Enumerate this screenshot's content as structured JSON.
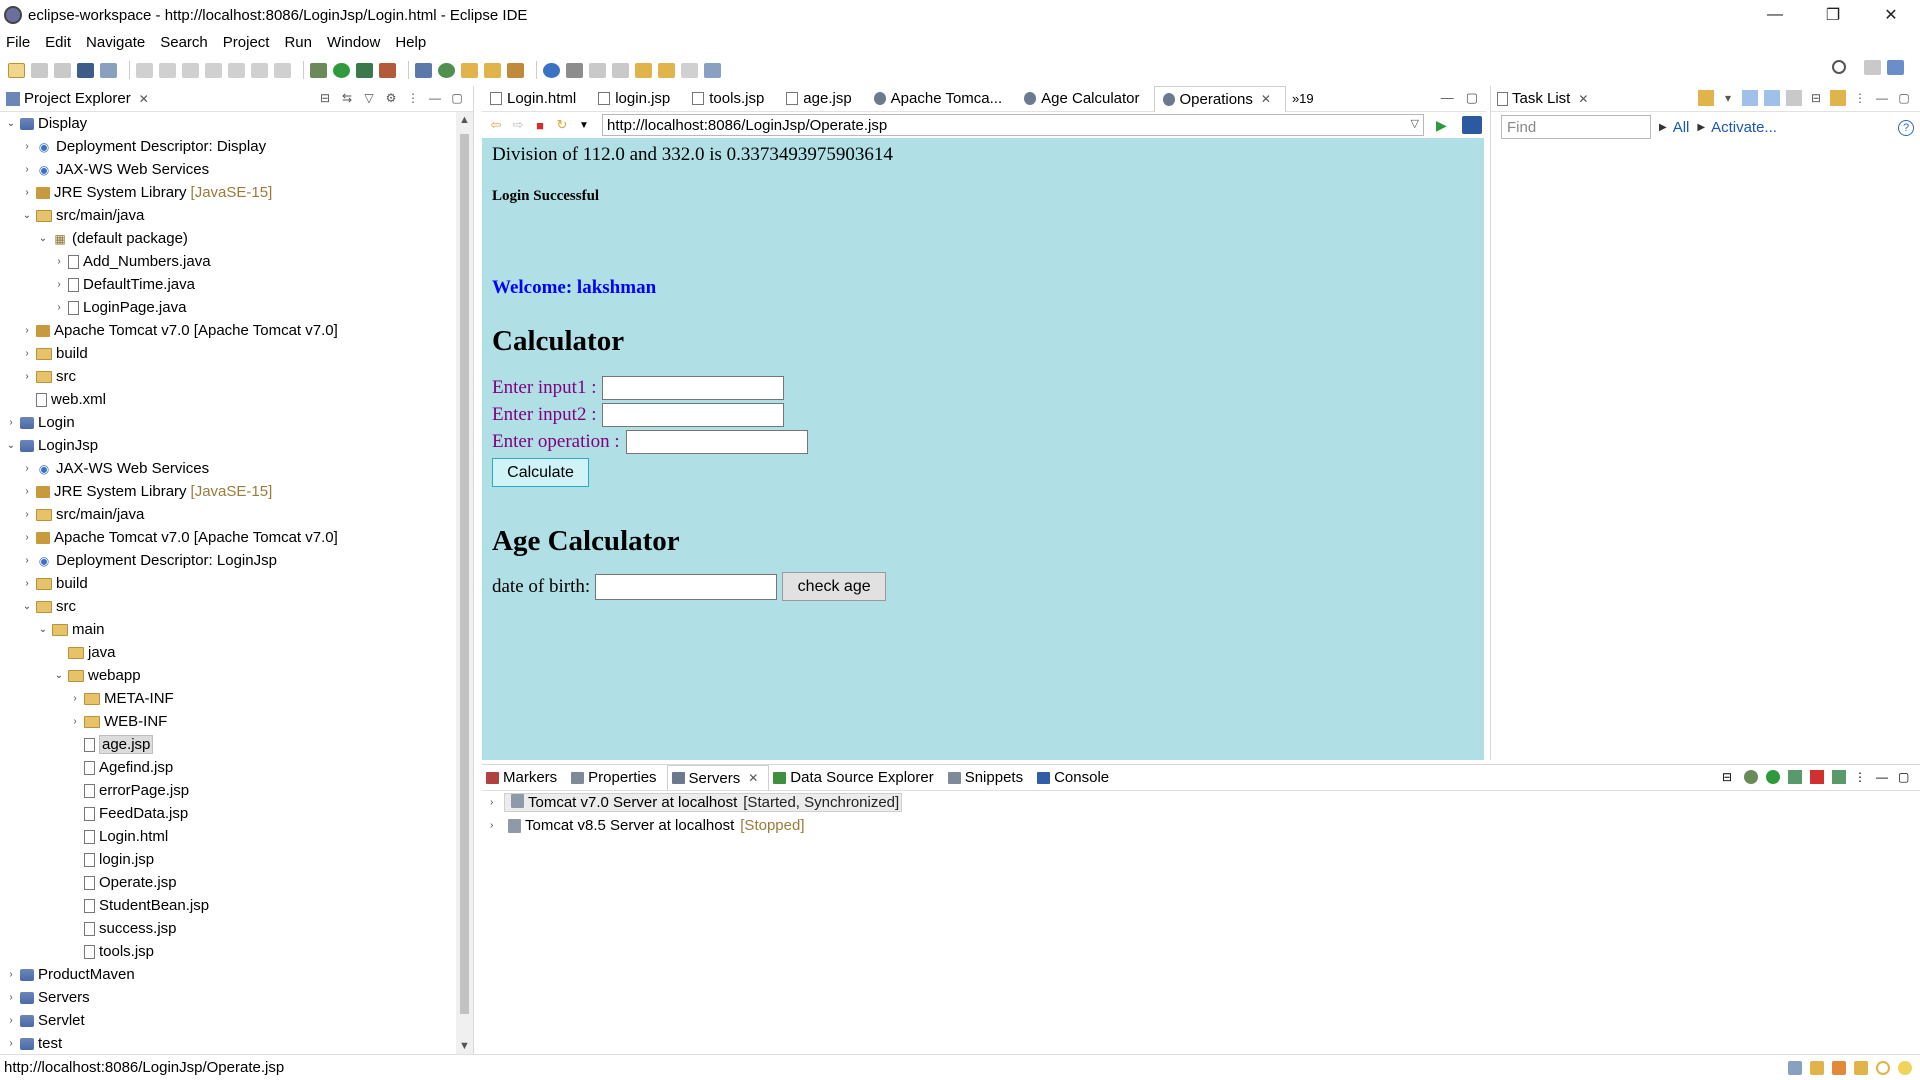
{
  "window": {
    "title": "eclipse-workspace - http://localhost:8086/LoginJsp/Login.html - Eclipse IDE",
    "controls": [
      "—",
      "❐",
      "✕"
    ]
  },
  "menu": [
    "File",
    "Edit",
    "Navigate",
    "Search",
    "Project",
    "Run",
    "Window",
    "Help"
  ],
  "explorer": {
    "title": "Project Explorer",
    "tree": [
      {
        "depth": 0,
        "twisty": "open",
        "icon": "project",
        "label": "Display"
      },
      {
        "depth": 1,
        "twisty": "closed",
        "icon": "globe",
        "label": "Deployment Descriptor: Display"
      },
      {
        "depth": 1,
        "twisty": "closed",
        "icon": "globe",
        "label": "JAX-WS Web Services"
      },
      {
        "depth": 1,
        "twisty": "closed",
        "icon": "lib",
        "label": "JRE System Library",
        "decoration": "[JavaSE-15]"
      },
      {
        "depth": 1,
        "twisty": "open",
        "icon": "folder",
        "label": "src/main/java"
      },
      {
        "depth": 2,
        "twisty": "open",
        "icon": "package",
        "label": "(default package)"
      },
      {
        "depth": 3,
        "twisty": "closed",
        "icon": "file",
        "label": "Add_Numbers.java"
      },
      {
        "depth": 3,
        "twisty": "closed",
        "icon": "file",
        "label": "DefaultTime.java"
      },
      {
        "depth": 3,
        "twisty": "closed",
        "icon": "file",
        "label": "LoginPage.java"
      },
      {
        "depth": 1,
        "twisty": "closed",
        "icon": "lib",
        "label": "Apache Tomcat v7.0 [Apache Tomcat v7.0]"
      },
      {
        "depth": 1,
        "twisty": "closed",
        "icon": "folder",
        "label": "build"
      },
      {
        "depth": 1,
        "twisty": "closed",
        "icon": "folder",
        "label": "src"
      },
      {
        "depth": 1,
        "twisty": "none",
        "icon": "file",
        "label": "web.xml"
      },
      {
        "depth": 0,
        "twisty": "closed",
        "icon": "project",
        "label": "Login"
      },
      {
        "depth": 0,
        "twisty": "open",
        "icon": "project",
        "label": "LoginJsp"
      },
      {
        "depth": 1,
        "twisty": "closed",
        "icon": "globe",
        "label": "JAX-WS Web Services"
      },
      {
        "depth": 1,
        "twisty": "closed",
        "icon": "lib",
        "label": "JRE System Library",
        "decoration": "[JavaSE-15]"
      },
      {
        "depth": 1,
        "twisty": "closed",
        "icon": "folder",
        "label": "src/main/java"
      },
      {
        "depth": 1,
        "twisty": "closed",
        "icon": "lib",
        "label": "Apache Tomcat v7.0 [Apache Tomcat v7.0]"
      },
      {
        "depth": 1,
        "twisty": "closed",
        "icon": "globe",
        "label": "Deployment Descriptor: LoginJsp"
      },
      {
        "depth": 1,
        "twisty": "closed",
        "icon": "folder",
        "label": "build"
      },
      {
        "depth": 1,
        "twisty": "open",
        "icon": "folder",
        "label": "src"
      },
      {
        "depth": 2,
        "twisty": "open",
        "icon": "folder",
        "label": "main"
      },
      {
        "depth": 3,
        "twisty": "none",
        "icon": "folder",
        "label": "java"
      },
      {
        "depth": 3,
        "twisty": "open",
        "icon": "folder",
        "label": "webapp"
      },
      {
        "depth": 4,
        "twisty": "closed",
        "icon": "folder",
        "label": "META-INF"
      },
      {
        "depth": 4,
        "twisty": "closed",
        "icon": "folder",
        "label": "WEB-INF"
      },
      {
        "depth": 4,
        "twisty": "none",
        "icon": "file",
        "label": "age.jsp",
        "selected": true
      },
      {
        "depth": 4,
        "twisty": "none",
        "icon": "file",
        "label": "Agefind.jsp"
      },
      {
        "depth": 4,
        "twisty": "none",
        "icon": "file",
        "label": "errorPage.jsp"
      },
      {
        "depth": 4,
        "twisty": "none",
        "icon": "file",
        "label": "FeedData.jsp"
      },
      {
        "depth": 4,
        "twisty": "none",
        "icon": "file",
        "label": "Login.html"
      },
      {
        "depth": 4,
        "twisty": "none",
        "icon": "file",
        "label": "login.jsp"
      },
      {
        "depth": 4,
        "twisty": "none",
        "icon": "file",
        "label": "Operate.jsp"
      },
      {
        "depth": 4,
        "twisty": "none",
        "icon": "file",
        "label": "StudentBean.jsp"
      },
      {
        "depth": 4,
        "twisty": "none",
        "icon": "file",
        "label": "success.jsp"
      },
      {
        "depth": 4,
        "twisty": "none",
        "icon": "file",
        "label": "tools.jsp"
      },
      {
        "depth": 0,
        "twisty": "closed",
        "icon": "project",
        "label": "ProductMaven"
      },
      {
        "depth": 0,
        "twisty": "closed",
        "icon": "project",
        "label": "Servers"
      },
      {
        "depth": 0,
        "twisty": "closed",
        "icon": "project",
        "label": "Servlet"
      },
      {
        "depth": 0,
        "twisty": "closed",
        "icon": "project",
        "label": "test"
      }
    ]
  },
  "editor": {
    "tabs": [
      {
        "label": "Login.html",
        "icon": "file"
      },
      {
        "label": "login.jsp",
        "icon": "file"
      },
      {
        "label": "tools.jsp",
        "icon": "file"
      },
      {
        "label": "age.jsp",
        "icon": "file"
      },
      {
        "label": "Apache Tomca...",
        "icon": "globe"
      },
      {
        "label": "Age Calculator",
        "icon": "globe"
      },
      {
        "label": "Operations",
        "icon": "globe",
        "active": true
      }
    ],
    "more_tabs": "»19",
    "url": "http://localhost:8086/LoginJsp/Operate.jsp"
  },
  "page": {
    "result": "Division of 112.0 and 332.0 is 0.3373493975903614",
    "login_status": "Login Successful",
    "welcome": "Welcome: lakshman",
    "calc_heading": "Calculator",
    "input1_label": "Enter input1 :",
    "input2_label": "Enter input2 :",
    "operation_label": "Enter operation :",
    "calculate_button": "Calculate",
    "age_heading": "Age Calculator",
    "dob_label": "date of birth:",
    "check_age_button": "check age"
  },
  "tasklist": {
    "title": "Task List",
    "find_placeholder": "Find",
    "all_link": "All",
    "activate_link": "Activate..."
  },
  "bottom": {
    "tabs": [
      {
        "label": "Markers",
        "color": "#b0413e"
      },
      {
        "label": "Properties",
        "color": "#7f8a99"
      },
      {
        "label": "Servers",
        "color": "#6b7a8f",
        "active": true
      },
      {
        "label": "Data Source Explorer",
        "color": "#3f8f3f"
      },
      {
        "label": "Snippets",
        "color": "#7f8a99"
      },
      {
        "label": "Console",
        "color": "#2f5da8"
      }
    ],
    "servers": [
      {
        "name": "Tomcat v7.0 Server at localhost",
        "status": "[Started, Synchronized]",
        "selected": true
      },
      {
        "name": "Tomcat v8.5 Server at localhost",
        "status": "[Stopped]"
      }
    ]
  },
  "statusbar": {
    "text": "http://localhost:8086/LoginJsp/Operate.jsp"
  },
  "colors": {
    "page_background": "#b0e0e6",
    "welcome_text": "#0000ff",
    "form_label": "#800080",
    "decoration": "#9a7b3a",
    "link": "#1a57b4"
  }
}
